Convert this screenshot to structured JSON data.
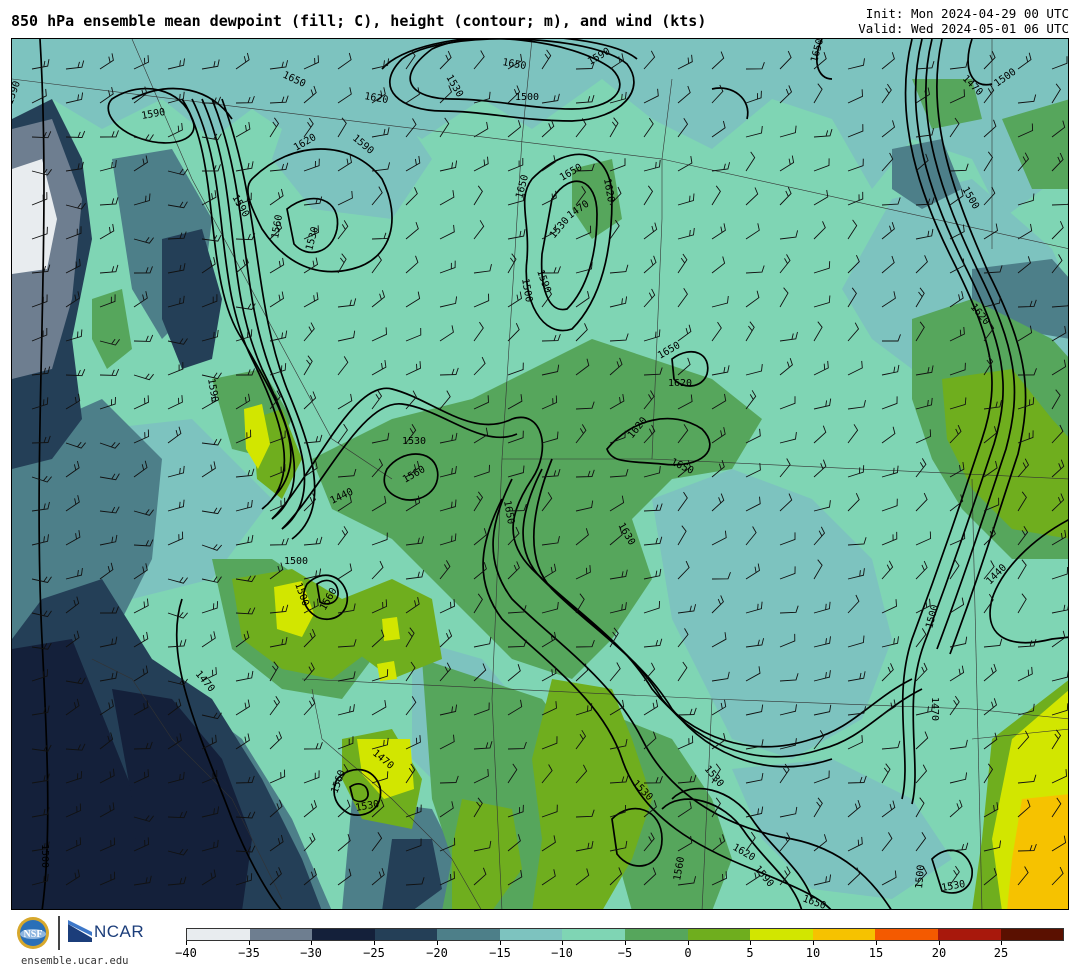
{
  "header": {
    "title": "850 hPa ensemble mean dewpoint (fill; C), height (contour; m), and wind (kts)",
    "init": "Init: Mon 2024-04-29 00 UTC",
    "valid": "Valid: Wed 2024-05-01 06 UTC"
  },
  "colorbar": {
    "tick_labels": [
      "−40",
      "−35",
      "−30",
      "−25",
      "−20",
      "−15",
      "−10",
      "−5",
      "0",
      "5",
      "10",
      "15",
      "20",
      "25"
    ],
    "bins": [
      {
        "range": "-40 to -35",
        "color": "#e8ecef"
      },
      {
        "range": "-35 to -30",
        "color": "#6e7e90"
      },
      {
        "range": "-30 to -25",
        "color": "#14203a"
      },
      {
        "range": "-25 to -20",
        "color": "#243f57"
      },
      {
        "range": "-20 to -15",
        "color": "#4d7f89"
      },
      {
        "range": "-15 to -10",
        "color": "#7dc3bf"
      },
      {
        "range": "-10 to -5",
        "color": "#7fd5b4"
      },
      {
        "range": "-5 to 0",
        "color": "#56a65c"
      },
      {
        "range": "0 to 5",
        "color": "#6fae1e"
      },
      {
        "range": "5 to 10",
        "color": "#d2e600"
      },
      {
        "range": "10 to 15",
        "color": "#f6c200"
      },
      {
        "range": "15 to 20",
        "color": "#f45a00"
      },
      {
        "range": "20 to 25",
        "color": "#a8180c"
      },
      {
        "range": "25 to 30",
        "color": "#5a1000"
      }
    ]
  },
  "contour_labels": [
    "1590",
    "1650",
    "1620",
    "1530",
    "1650",
    "1590",
    "1500",
    "1590",
    "1620",
    "1590",
    "1650",
    "1560",
    "1530",
    "1650",
    "1530",
    "1470",
    "1500",
    "1590",
    "1620",
    "1650",
    "1530",
    "1560",
    "1440",
    "1620",
    "1650",
    "1620",
    "1630",
    "1650",
    "1500",
    "1590",
    "1500",
    "1560",
    "1470",
    "1470",
    "1560",
    "1500",
    "1530",
    "1500",
    "1530",
    "1470",
    "1530",
    "1620",
    "1590",
    "1650",
    "1560",
    "1500",
    "1530",
    "1500",
    "1470",
    "1440",
    "1650",
    "1620",
    "1500",
    "1590"
  ],
  "logos": {
    "nsf": "NSF",
    "ncar": "NCAR",
    "site": "ensemble.ucar.edu"
  }
}
